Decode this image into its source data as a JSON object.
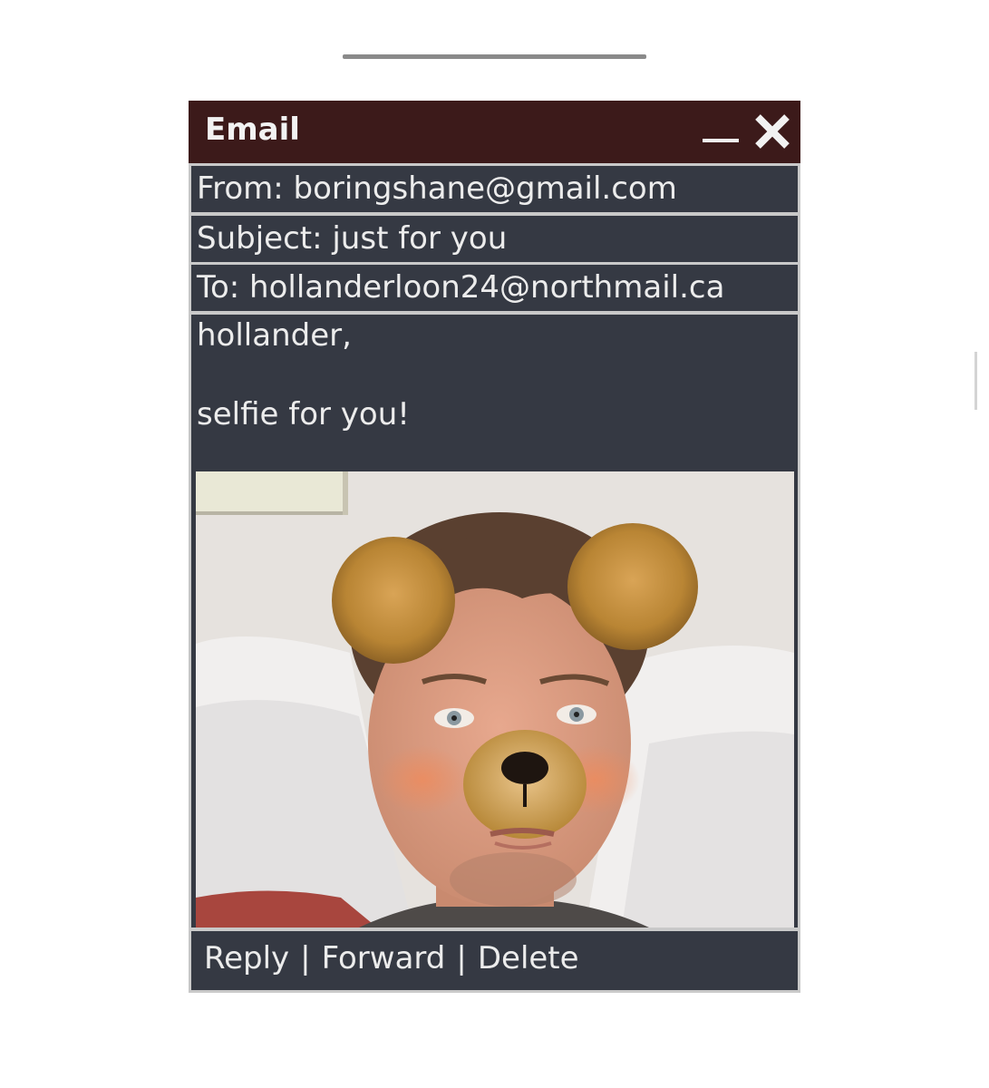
{
  "window": {
    "title": "Email",
    "minimize_label": "_",
    "close_icon": "close-icon"
  },
  "email": {
    "from": "From: boringshane@gmail.com",
    "subject": "Subject: just for you",
    "to": "To: hollanderloon24@northmail.ca",
    "greeting": "hollander,",
    "message": "selfie for you!",
    "attachment": "selfie-photo"
  },
  "actions": {
    "reply": "Reply",
    "separator": "|",
    "forward": "Forward",
    "delete": "Delete"
  },
  "colors": {
    "titlebar": "#3c1a1a",
    "panel": "#353943",
    "text": "#ececec",
    "border": "#c9c9c9"
  }
}
